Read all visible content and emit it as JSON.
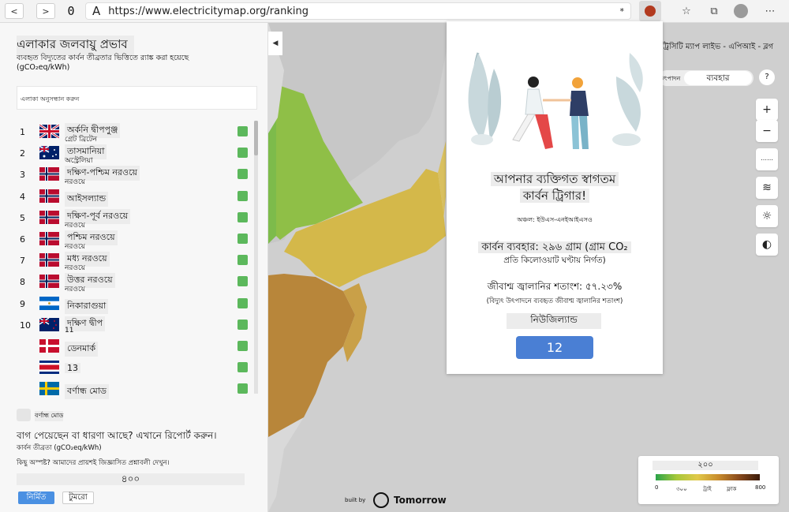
{
  "browser": {
    "url": "https://www.electricitymap.org/ranking",
    "back_icon": "<",
    "forward_icon": ">",
    "reload_icon": "0",
    "star_icon": "*"
  },
  "sidebar": {
    "title": "এলাকার জলবায়ু প্রভাব",
    "subtitle": "ব্যবহৃত বিদ্যুতের কার্বন তীব্রতার ভিত্তিতে র‍্যাঙ্ক করা হয়েছে",
    "unit": "(gCO₂eq/kWh)",
    "search_placeholder": "এলাকা অনুসন্ধান করুন",
    "zones": [
      {
        "rank": "1",
        "name": "অর্কনি দ্বীপপুঞ্জ",
        "country": "গ্রেট ব্রিটেন",
        "flag": "gb"
      },
      {
        "rank": "2",
        "name": "তাসমানিয়া",
        "country": "অস্ট্রেলিয়া",
        "flag": "au"
      },
      {
        "rank": "3",
        "name": "দক্ষিণ-পশ্চিম নরওয়ে",
        "country": "নরওয়ে",
        "flag": "no"
      },
      {
        "rank": "4",
        "name": "আইসল্যান্ড",
        "country": "",
        "flag": "no"
      },
      {
        "rank": "5",
        "name": "দক্ষিণ-পূর্ব নরওয়ে",
        "country": "নরওয়ে",
        "flag": "no"
      },
      {
        "rank": "6",
        "name": "পশ্চিম নরওয়ে",
        "country": "নরওয়ে",
        "flag": "no"
      },
      {
        "rank": "7",
        "name": "মধ্য নরওয়ে",
        "country": "নরওয়ে",
        "flag": "no"
      },
      {
        "rank": "8",
        "name": "উত্তর নরওয়ে",
        "country": "নরওয়ে",
        "flag": "no"
      },
      {
        "rank": "9",
        "name": "নিকারাগুয়া",
        "country": "",
        "flag": "ni"
      },
      {
        "rank": "10",
        "name": "দক্ষিণ দ্বীপ",
        "country": "11",
        "flag": "nz"
      },
      {
        "rank": "",
        "name": "ডেনমার্ক",
        "country": "",
        "flag": "dk"
      },
      {
        "rank": "",
        "name": "13",
        "country": "",
        "flag": "cr"
      },
      {
        "rank": "",
        "name": "বর্ণান্ধ মোড",
        "country": "",
        "flag": "se"
      }
    ],
    "colorblind_label": "বর্ণান্ধ মোড",
    "bug_report": "বাগ পেয়েছেন বা ধারণা আছে? এখানে রিপোর্ট করুন।",
    "bug_report_sub": "কার্বন তীব্রতা (gCO₂eq/kWh)",
    "faq": "কিছু অস্পষ্ট? আমাদের প্রায়শই জিজ্ঞাসিত প্রশ্নাবলী দেখুন।",
    "slider_value": "৪০০",
    "btn_primary": "নির্মিত",
    "btn_secondary": "টুমরো"
  },
  "map_nav": {
    "top_links": "ট্রিসিটি ম্যাপ লাইভ - এপিআই - ব্লগ",
    "tab_left": "উৎপাদন",
    "tab_right": "ব্যবহার",
    "tab_extra": "?",
    "zoom_in": "+",
    "zoom_out": "−",
    "language_icon": "globe-icon",
    "wind_icon": "wind-icon",
    "sun_icon": "sun-icon",
    "theme_icon": "contrast-icon"
  },
  "modal": {
    "title_line1": "আপনার ব্যক্তিগত স্বাগতম",
    "title_line2": "কার্বন ট্রিগার!",
    "zone_label": "অঞ্চল: ইউএস-এনইআইএসও",
    "carbon_label": "কার্বন ব্যবহার: ২৯৬ গ্রাম (গ্রাম CO₂",
    "carbon_sub": "প্রতি কিলোওয়াট ঘণ্টায় নির্গত)",
    "fossil_label": "জীবাশ্ম জ্বালানির শতাংশ: ৫৭.২৩%",
    "fossil_sub": "(বিদ্যুৎ উৎপাদনে ব্যবহৃত জীবাশ্ম জ্বালানির শতাংশ)",
    "country": "নিউজিল্যান্ড",
    "button_label": "12"
  },
  "legend": {
    "title": "২০০",
    "ticks": [
      "0",
      "৩০০",
      "ট্রাই",
      "ফ্লাক",
      "800"
    ]
  },
  "footer": {
    "built_by": "built by",
    "brand": "Tomorrow"
  },
  "colors": {
    "accent": "#4a90e2",
    "green_low": "#5cb85c",
    "map_yellow": "#d4b84a",
    "map_brown": "#b88a3a"
  }
}
